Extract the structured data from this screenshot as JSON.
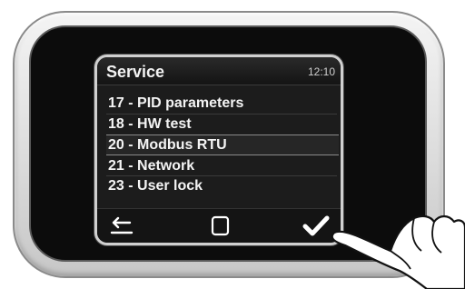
{
  "screen": {
    "title": "Service",
    "time": "12:10"
  },
  "menu": {
    "items": [
      {
        "label": "17 - PID parameters"
      },
      {
        "label": "18 - HW test"
      },
      {
        "label": "20 - Modbus RTU",
        "selected": true
      },
      {
        "label": "21 - Network"
      },
      {
        "label": "23 - User lock"
      }
    ]
  },
  "softkeys": {
    "left_icon": "back-arrow-icon",
    "center_icon": "square-icon",
    "right_icon": "checkmark-icon"
  },
  "colors": {
    "screen_bg": "#1c1c1c",
    "text": "#f4f4f4",
    "bezel": "#dcdcdc"
  }
}
